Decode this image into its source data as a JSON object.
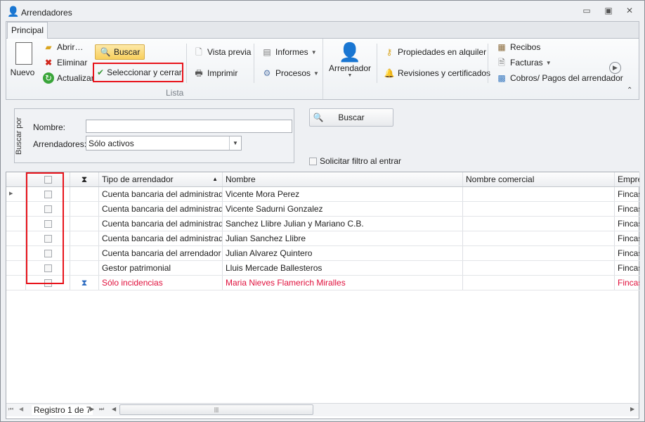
{
  "window": {
    "title": "Arrendadores"
  },
  "ribbon": {
    "tab": "Principal",
    "group_label": "Lista",
    "nuevo": "Nuevo",
    "abrir": "Abrir…",
    "eliminar": "Eliminar",
    "actualizar": "Actualizar",
    "buscar": "Buscar",
    "seleccionar": "Seleccionar y cerrar",
    "vista_previa": "Vista previa",
    "imprimir": "Imprimir",
    "informes": "Informes",
    "procesos": "Procesos",
    "arrendador": "Arrendador",
    "propiedades": "Propiedades en alquiler",
    "revisiones": "Revisiones y certificados",
    "recibos": "Recibos",
    "facturas": "Facturas",
    "cobros": "Cobros/ Pagos del arrendador"
  },
  "search": {
    "panel_label": "Buscar por",
    "nombre_label": "Nombre:",
    "nombre_value": "",
    "arrendadores_label": "Arrendadores:",
    "arrendadores_value": "Sólo activos",
    "buscar_button": "Buscar",
    "filtro_label": "Solicitar filtro al entrar"
  },
  "grid": {
    "columns": [
      "Tipo de arrendador",
      "Nombre",
      "Nombre comercial",
      "Empre"
    ],
    "rows": [
      {
        "tipo": "Cuenta bancaria del administrador",
        "nombre": "Vicente Mora Perez",
        "comercial": "",
        "empresa": "Fincas"
      },
      {
        "tipo": "Cuenta bancaria del administrador",
        "nombre": "Vicente Sadurni Gonzalez",
        "comercial": "",
        "empresa": "Fincas"
      },
      {
        "tipo": "Cuenta bancaria del administrador",
        "nombre": "Sanchez Llibre Julian y Mariano C.B.",
        "comercial": "",
        "empresa": "Fincas"
      },
      {
        "tipo": "Cuenta bancaria del administrador",
        "nombre": "Julian Sanchez Llibre",
        "comercial": "",
        "empresa": "Fincas"
      },
      {
        "tipo": "Cuenta bancaria del arrendador",
        "nombre": "Julian Alvarez Quintero",
        "comercial": "",
        "empresa": "Fincas"
      },
      {
        "tipo": "Gestor patrimonial",
        "nombre": "Lluis Mercade Ballesteros",
        "comercial": "",
        "empresa": "Fincas"
      },
      {
        "tipo": "Sólo incidencias",
        "nombre": "Maria Nieves Flamerich Miralles",
        "comercial": "",
        "empresa": "Fincas"
      }
    ]
  },
  "navigator": {
    "record": "Registro 1 de 7"
  }
}
